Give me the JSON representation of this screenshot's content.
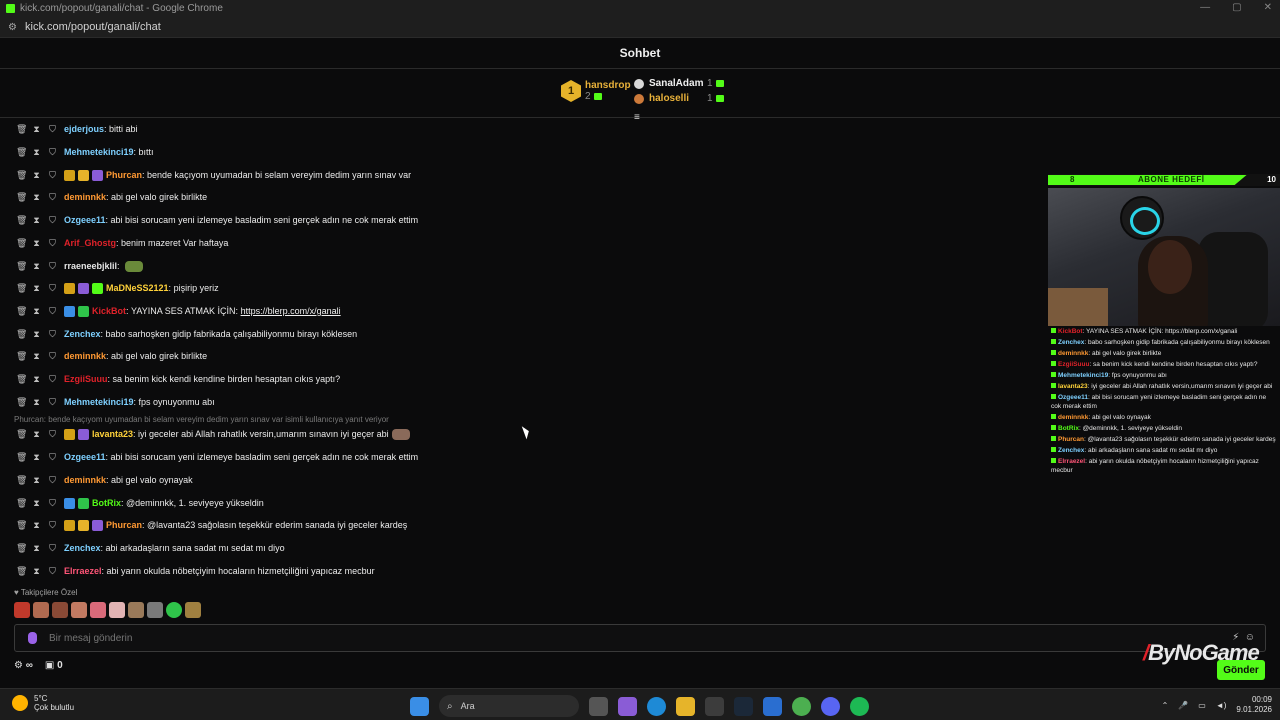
{
  "window": {
    "title": "kick.com/popout/ganali/chat - Google Chrome",
    "url": "kick.com/popout/ganali/chat"
  },
  "header": {
    "title": "Sohbet"
  },
  "leaderboard": {
    "first": {
      "rank": "1",
      "name": "hansdrop",
      "count": "2"
    },
    "second": {
      "name": "SanalAdam",
      "count": "1"
    },
    "third": {
      "name": "haloselli",
      "count": "1"
    }
  },
  "messages": [
    {
      "user": "ejderjous",
      "color": "#7ed0ff",
      "text": "bitti abi"
    },
    {
      "user": "Mehmetekinci19",
      "color": "#7ed0ff",
      "text": "bıttı"
    },
    {
      "user": "Phurcan",
      "color": "#ff9933",
      "text": "bende kaçıyom uyumadan bi selam vereyim dedim yarın sınav var"
    },
    {
      "user": "deminnkk",
      "color": "#ff9933",
      "text": "abi gel valo girek birlikte"
    },
    {
      "user": "Ozgeee11",
      "color": "#7ed0ff",
      "text": "abi bisi sorucam yeni izlemeye basladim seni gerçek adın ne cok merak ettim"
    },
    {
      "user": "Arif_Ghostg",
      "color": "#e0222a",
      "text": "benim mazeret Var haftaya"
    },
    {
      "user": "rraeneebjklil",
      "color": "#e6e6e6",
      "text": ""
    },
    {
      "user": "MaDNeSS2121",
      "color": "#ffd23a",
      "text": "pişirip yeriz"
    },
    {
      "user": "KickBot",
      "color": "#e0222a",
      "text": "YAYINA SES ATMAK İÇİN:",
      "link": "https://blerp.com/x/ganali"
    },
    {
      "user": "Zenchex",
      "color": "#7ed0ff",
      "text": "babo sarhoşken gidip fabrikada çalışabiliyonmu birayı köklesen"
    },
    {
      "user": "deminnkk",
      "color": "#ff9933",
      "text": "abi gel valo girek birlikte"
    },
    {
      "user": "EzgiiSuuu",
      "color": "#e0222a",
      "text": "sa benim kick kendi kendine birden hesaptan cıkıs yaptı?"
    },
    {
      "user": "Mehmetekinci19",
      "color": "#7ed0ff",
      "text": "fps oynuyonmu abı"
    },
    {
      "user": "lavanta23",
      "color": "#ffd23a",
      "text": "iyi geceler abi Allah rahatlık versin,umarım sınavın iyi geçer abi"
    },
    {
      "user": "Ozgeee11",
      "color": "#7ed0ff",
      "text": "abi bisi sorucam yeni izlemeye basladim seni gerçek adın ne cok merak ettim"
    },
    {
      "user": "deminnkk",
      "color": "#ff9933",
      "text": "abi gel valo oynayak"
    },
    {
      "user": "BotRix",
      "color": "#53fc18",
      "text": "@deminnkk, 1. seviyeye yükseldin"
    },
    {
      "user": "Phurcan",
      "color": "#ff9933",
      "text": "@lavanta23 sağolasın teşekkür ederim sanada iyi geceler kardeş"
    },
    {
      "user": "Zenchex",
      "color": "#7ed0ff",
      "text": "abi arkadaşların sana sadat mı sedat mı diyo"
    },
    {
      "user": "Elrraezel",
      "color": "#ff5577",
      "text": "abi yarın okulda nöbetçiyim hocaların hizmetçiliğini yapıcaz mecbur"
    }
  ],
  "reply_hint": "Phurcan: bende kaçıyom uyumadan bi selam vereyim dedim yarın sınav var isimli kullanıcıya yanıt veriyor",
  "followers_label": "Takipçilere Özel",
  "input": {
    "placeholder": "Bir mesaj gönderin"
  },
  "bottom": {
    "points": "0"
  },
  "send_label": "Gönder",
  "watermark": "ByNoGame",
  "overlay": {
    "goal_current": "8",
    "goal_title": "ABONE HEDEFİ",
    "goal_target": "10",
    "lines": [
      {
        "user": "KickBot",
        "text": ": YAYINA SES ATMAK İÇİN: https://blerp.com/x/ganali"
      },
      {
        "user": "Zenchex",
        "text": ": babo sarhoşken gidip fabrikada çalışabiliyonmu birayı köklesen"
      },
      {
        "user": "deminnkk",
        "text": ": abi gel valo girek birlikte"
      },
      {
        "user": "EzgiiSuuu",
        "text": ": sa benim kick kendi kendine birden hesaptan cıkıs yaptı?"
      },
      {
        "user": "Mehmetekinci19",
        "text": ": fps oynuyonmu abı"
      },
      {
        "user": "lavanta23",
        "text": ": iyi geceler abi Allah rahatlık versin,umarım sınavın iyi geçer abi"
      },
      {
        "user": "Ozgeee11",
        "text": ": abi bisi sorucam yeni izlemeye basladim seni gerçek adın ne cok merak ettim"
      },
      {
        "user": "deminnkk",
        "text": ": abi gel valo oynayak"
      },
      {
        "user": "BotRix",
        "text": ": @deminnkk, 1. seviyeye yükseldin"
      },
      {
        "user": "Phurcan",
        "text": ": @lavanta23 sağolasın teşekkür ederim sanada iyi geceler kardeş"
      },
      {
        "user": "Zenchex",
        "text": ": abi arkadaşların sana sadat mı sedat mı diyo"
      },
      {
        "user": "Elrraezel",
        "text": ": abi yarın okulda nöbetçiyim hocaların hizmetçiliğini yapıcaz mecbur"
      }
    ]
  },
  "taskbar": {
    "weather_temp": "5°C",
    "weather_desc": "Çok bulutlu",
    "search_label": "Ara",
    "time": "00:09",
    "date": "9.01.2026"
  },
  "colors": {
    "kick_green": "#53fc18",
    "background": "#0b0b0c"
  }
}
